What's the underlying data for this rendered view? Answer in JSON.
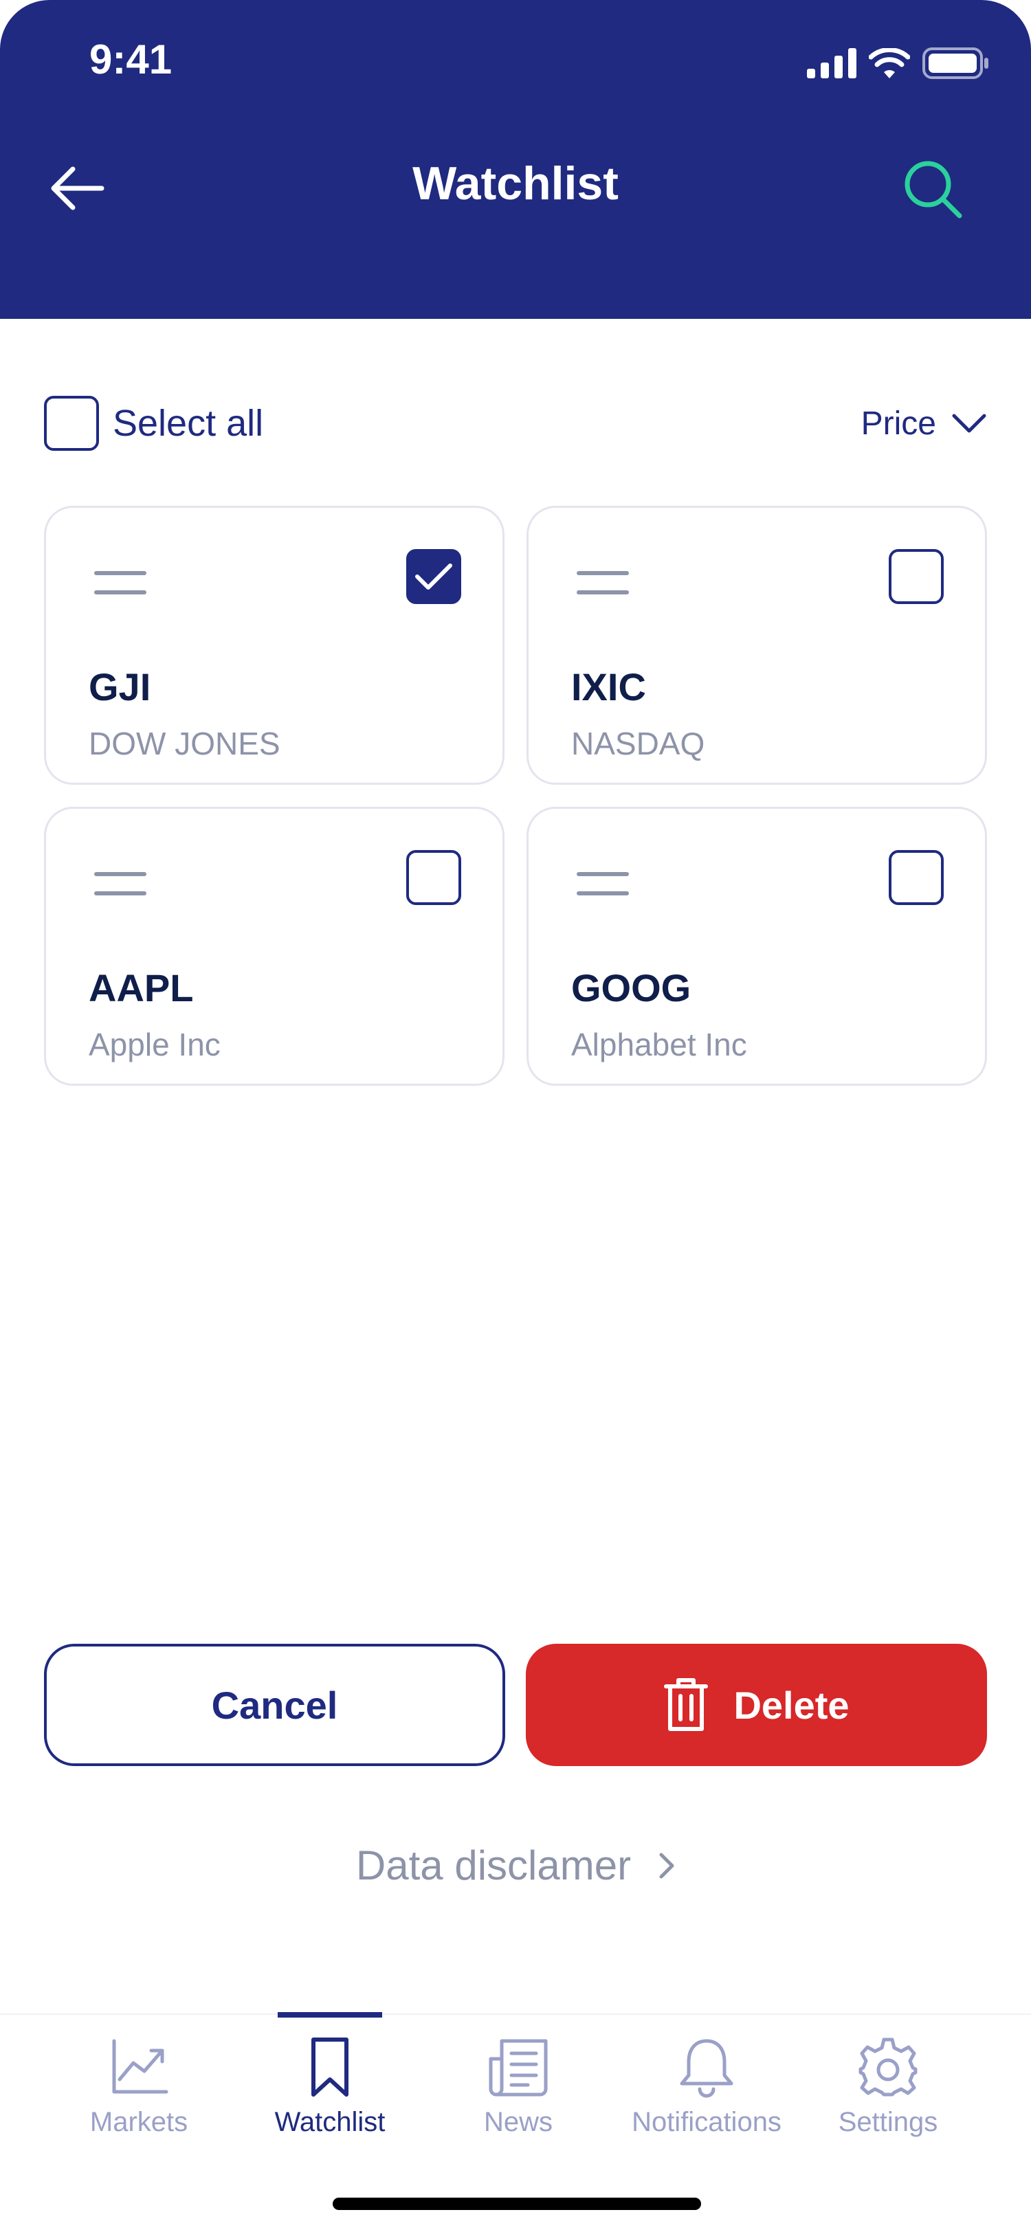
{
  "status_bar": {
    "time": "9:41"
  },
  "header": {
    "title": "Watchlist"
  },
  "toolbar": {
    "select_all_label": "Select all",
    "sort_label": "Price"
  },
  "cards": [
    {
      "ticker": "GJI",
      "company": "DOW JONES",
      "checked": true
    },
    {
      "ticker": "IXIC",
      "company": "NASDAQ",
      "checked": false
    },
    {
      "ticker": "AAPL",
      "company": "Apple Inc",
      "checked": false
    },
    {
      "ticker": "GOOG",
      "company": "Alphabet Inc",
      "checked": false
    }
  ],
  "actions": {
    "cancel_label": "Cancel",
    "delete_label": "Delete"
  },
  "disclaimer": {
    "label": "Data disclamer"
  },
  "tabbar": {
    "items": [
      {
        "label": "Markets",
        "icon": "chart-icon",
        "active": false
      },
      {
        "label": "Watchlist",
        "icon": "bookmark-icon",
        "active": true
      },
      {
        "label": "News",
        "icon": "newspaper-icon",
        "active": false
      },
      {
        "label": "Notifications",
        "icon": "bell-icon",
        "active": false
      },
      {
        "label": "Settings",
        "icon": "gear-icon",
        "active": false
      }
    ]
  },
  "colors": {
    "header_bg": "#1f2a80",
    "search_accent": "#2bd19c",
    "delete_bg": "#d7282a",
    "text_muted": "#8d93a8",
    "tab_inactive": "#9aa0c7"
  }
}
